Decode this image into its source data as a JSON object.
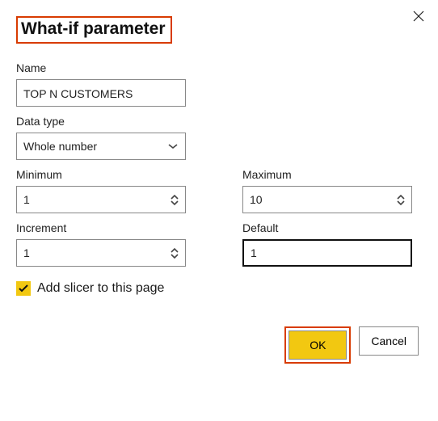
{
  "dialog": {
    "title": "What-if parameter",
    "name_label": "Name",
    "name_value": "TOP N CUSTOMERS",
    "datatype_label": "Data type",
    "datatype_value": "Whole number",
    "minimum_label": "Minimum",
    "minimum_value": "1",
    "maximum_label": "Maximum",
    "maximum_value": "10",
    "increment_label": "Increment",
    "increment_value": "1",
    "default_label": "Default",
    "default_value": "1",
    "add_slicer_label": "Add slicer to this page",
    "ok_label": "OK",
    "cancel_label": "Cancel",
    "colors": {
      "accent": "#f2c811",
      "highlight_border": "#d83b01"
    }
  }
}
